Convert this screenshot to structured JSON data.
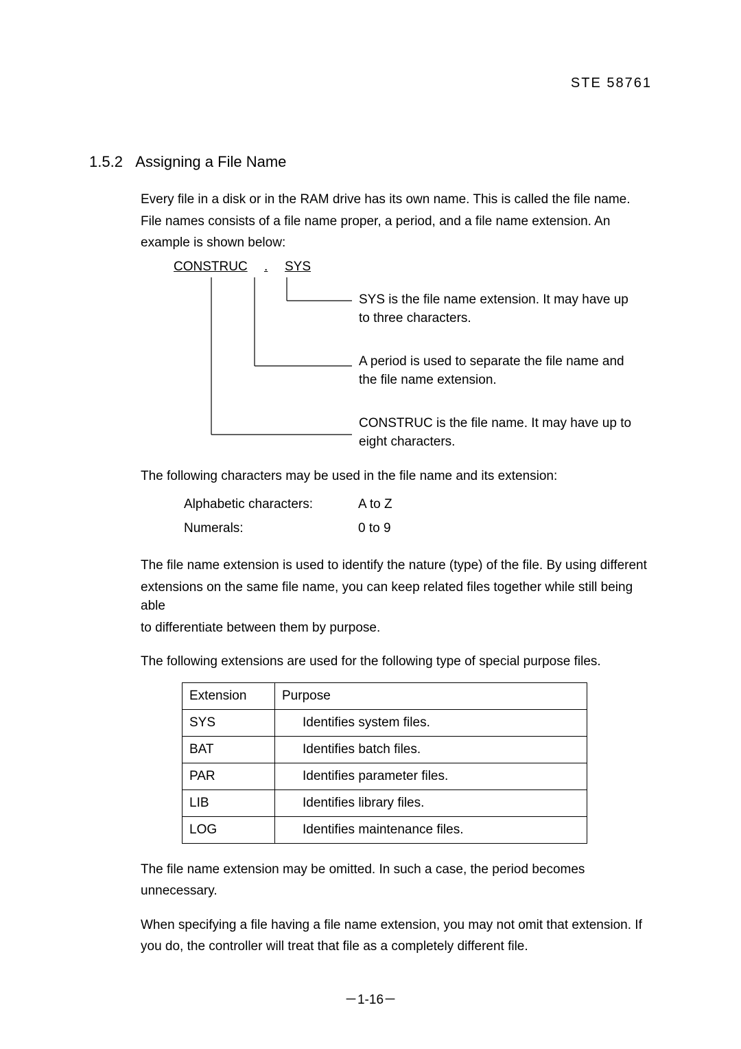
{
  "header": {
    "doc_code": "STE  58761"
  },
  "section": {
    "number": "1.5.2",
    "title": "Assigning a File Name"
  },
  "intro": {
    "p1a": "Every file in a disk or in the RAM drive has its own name.    This is called the file name.",
    "p1b": "File names consists of a file name proper, a period, and a file name extension.    An",
    "p1c": "example is shown below:"
  },
  "filename_parts": {
    "base": "CONSTRUC",
    "dot": ".",
    "ext": "SYS"
  },
  "diagram": {
    "sys_l1": "SYS is the file name extension. It may have up",
    "sys_l2": "to three characters.",
    "period_l1": "A period is used to separate the file name and",
    "period_l2": "the file name extension.",
    "base_l1": "CONSTRUC is the file name.    It may have up to",
    "base_l2": "eight characters."
  },
  "chars_para": "The following characters may be used in the file name and its extension:",
  "chars": {
    "alpha_label": "Alphabetic characters:",
    "alpha_range": "A to Z",
    "num_label": "Numerals:",
    "num_range": "0 to 9"
  },
  "ext_use": {
    "l1": "The file name extension is used to identify the nature (type) of the file.    By using different",
    "l2": "extensions on the same file name, you can keep related files together while still being able",
    "l3": "to differentiate between them by purpose."
  },
  "ext_table_para": "The following extensions are used for the following type of special purpose files.",
  "ext_table": {
    "head_ext": "Extension",
    "head_purpose": "Purpose",
    "rows": [
      {
        "ext": "SYS",
        "purpose": "Identifies system files."
      },
      {
        "ext": "BAT",
        "purpose": "Identifies batch files."
      },
      {
        "ext": "PAR",
        "purpose": "Identifies parameter files."
      },
      {
        "ext": "LIB",
        "purpose": "Identifies library files."
      },
      {
        "ext": "LOG",
        "purpose": "Identifies maintenance files."
      }
    ]
  },
  "omit": {
    "l1": "The file name extension may be omitted.    In such a case, the period becomes",
    "l2": "unnecessary."
  },
  "specify": {
    "l1": "When specifying a file having a file name extension, you may not omit that extension.    If",
    "l2": "you do, the controller will treat that file as a completely different file."
  },
  "page_number": "－1-16－"
}
